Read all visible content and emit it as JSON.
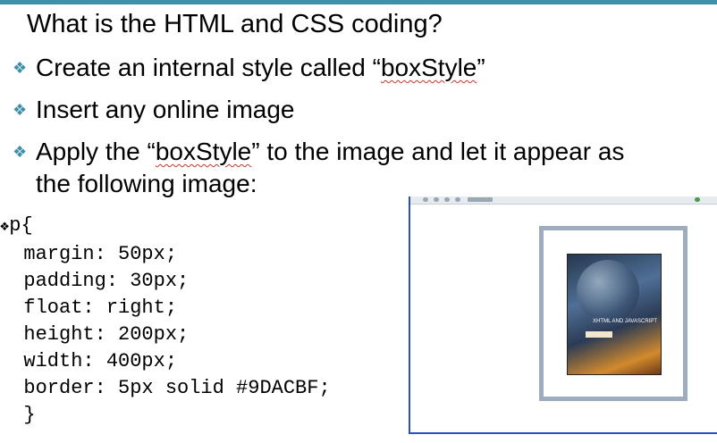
{
  "slide": {
    "title": "What is the HTML and CSS coding?",
    "bullets": [
      {
        "before": "Create an internal style called “",
        "highlight": "boxStyle",
        "after": "”"
      },
      {
        "text": "Insert any online image"
      },
      {
        "before": "Apply the “",
        "highlight": "boxStyle",
        "after": "” to the image and let it appear as",
        "continuation": "the following image:"
      }
    ],
    "code_lines": [
      "p{",
      "  margin: 50px;",
      "  padding: 30px;",
      "  float: right;",
      "  height: 200px;",
      "  width: 400px;",
      "  border: 5px solid #9DACBF;",
      "  }"
    ],
    "book_label": "XHTML AND JAVASCRIPT"
  },
  "colors": {
    "accent": "#3f8fa7",
    "box_border": "#9DACBF"
  },
  "icons": {
    "bullet": "diamond-bullet-icon"
  }
}
